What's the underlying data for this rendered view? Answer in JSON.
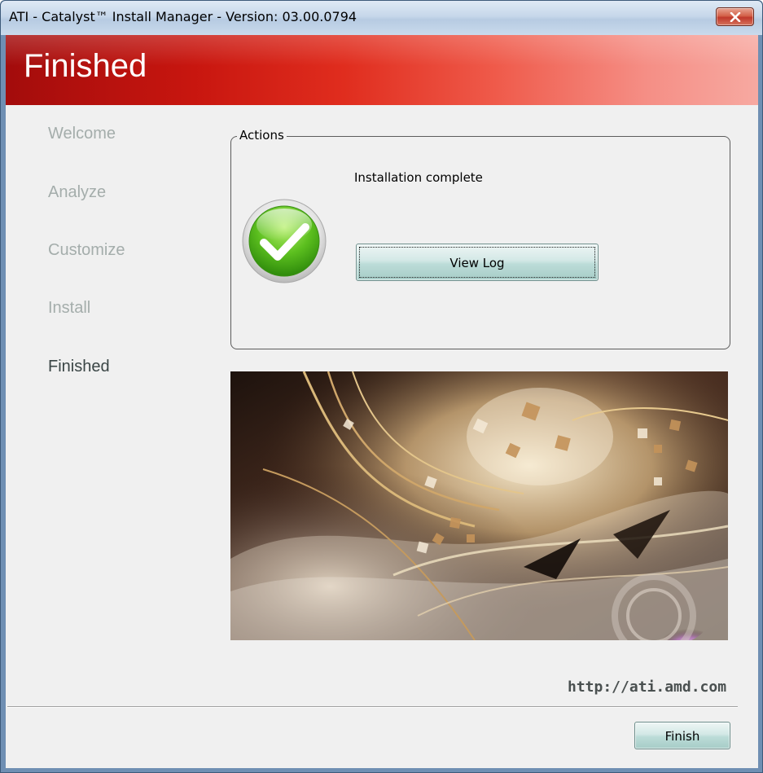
{
  "window": {
    "title": "ATI - Catalyst™ Install Manager - Version: 03.00.0794",
    "close_icon": "close-x-icon"
  },
  "banner": {
    "title": "Finished"
  },
  "steps": [
    {
      "label": "Welcome",
      "active": false
    },
    {
      "label": "Analyze",
      "active": false
    },
    {
      "label": "Customize",
      "active": false
    },
    {
      "label": "Install",
      "active": false
    },
    {
      "label": "Finished",
      "active": true
    }
  ],
  "actions": {
    "legend": "Actions",
    "status": "Installation complete",
    "status_icon": "check-circle-icon",
    "view_log_label": "View Log"
  },
  "footer": {
    "url": "http://ati.amd.com",
    "finish_label": "Finish"
  },
  "colors": {
    "banner_dark": "#a30c0c",
    "banner_light": "#f7a9a1",
    "step_inactive": "#a4adab",
    "step_active": "#3a4545",
    "check_green": "#5cbf1f"
  }
}
